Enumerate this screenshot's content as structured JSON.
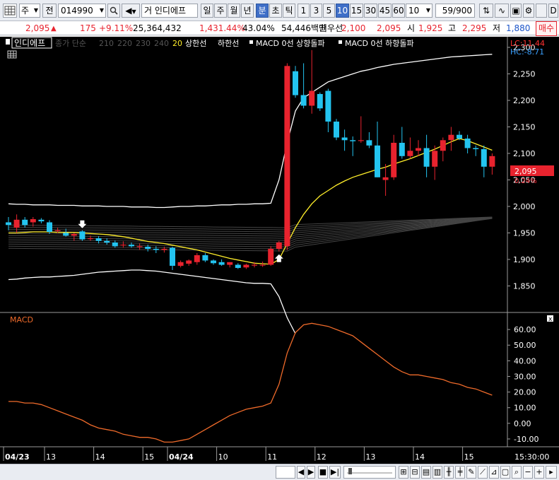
{
  "toolbar": {
    "market_select": "주",
    "prefix_select": "전",
    "stock_code": "014990",
    "stock_prefix": "거",
    "stock_name": "인디에프",
    "period_buttons": [
      "일",
      "주",
      "월",
      "년",
      "분",
      "초",
      "틱"
    ],
    "active_period": "분",
    "interval_buttons": [
      "1",
      "3",
      "5",
      "10",
      "15",
      "30",
      "45",
      "60"
    ],
    "active_interval": "10",
    "interval_value": "10",
    "count_value": "59",
    "count_total": "/900",
    "trailing_label": "D"
  },
  "quote": {
    "price": "2,095",
    "arrow": "▲",
    "change": "175",
    "change_pct": "+9.11%",
    "volume": "25,364,432",
    "volume_pct": "1,431.44%",
    "ratio": "43.04%",
    "amount": "54,446백만",
    "priority_label": "최우선",
    "ask": "2,100",
    "bid": "2,095",
    "open_label": "시",
    "open": "1,925",
    "high_label": "고",
    "high": "2,295",
    "low_label": "저",
    "low": "1,880",
    "trade_button": "매수"
  },
  "legend": {
    "name_tag": "인디에프",
    "ma_label": "종가 단순",
    "ma_periods": [
      "210",
      "220",
      "230",
      "240",
      "20"
    ],
    "upper_band": "상한선",
    "lower_band": "하한선",
    "macd_up": "MACD 0선 상향돌파",
    "macd_down": "MACD 0선 하향돌파"
  },
  "price_panel": {
    "lc": "LC:11.44",
    "hc": "HC:-8.71",
    "current_price_tag": "2,095",
    "current_pct_tag": "0.24%"
  },
  "macd_panel": {
    "title": "MACD",
    "close_icon": "x"
  },
  "x_axis_time": "15:30:00",
  "colors": {
    "up": "#e8232e",
    "down": "#23c4f0",
    "ma": "#ffee2a",
    "band": "#ffffff",
    "macd": "#ee6a2a",
    "bg": "#000000"
  },
  "chart_data": [
    {
      "type": "candlestick",
      "title": "인디에프",
      "ylim": [
        1800,
        2320
      ],
      "y_ticks": [
        "2,300",
        "2,250",
        "2,200",
        "2,150",
        "2,100",
        "2,050",
        "2,000",
        "1,950",
        "1,900",
        "1,850"
      ],
      "y_tick_values": [
        2300,
        2250,
        2200,
        2150,
        2100,
        2050,
        2000,
        1950,
        1900,
        1850
      ],
      "x_labels": [
        "04/23",
        "13",
        "14",
        "15",
        "04/24",
        "10",
        "11",
        "12",
        "13",
        "14",
        "15"
      ],
      "x_label_index": [
        0,
        5,
        11,
        17,
        20,
        26,
        32,
        38,
        44,
        50,
        56
      ],
      "candles": [
        {
          "o": 1970,
          "h": 1980,
          "l": 1955,
          "c": 1965
        },
        {
          "o": 1960,
          "h": 1985,
          "l": 1950,
          "c": 1975
        },
        {
          "o": 1975,
          "h": 1980,
          "l": 1960,
          "c": 1965
        },
        {
          "o": 1970,
          "h": 1980,
          "l": 1962,
          "c": 1976
        },
        {
          "o": 1975,
          "h": 1978,
          "l": 1968,
          "c": 1972
        },
        {
          "o": 1970,
          "h": 1974,
          "l": 1948,
          "c": 1952
        },
        {
          "o": 1955,
          "h": 1960,
          "l": 1950,
          "c": 1955
        },
        {
          "o": 1950,
          "h": 1958,
          "l": 1943,
          "c": 1945
        },
        {
          "o": 1945,
          "h": 1950,
          "l": 1935,
          "c": 1948
        },
        {
          "o": 1953,
          "h": 1955,
          "l": 1935,
          "c": 1938
        },
        {
          "o": 1940,
          "h": 1945,
          "l": 1935,
          "c": 1940
        },
        {
          "o": 1940,
          "h": 1944,
          "l": 1930,
          "c": 1935
        },
        {
          "o": 1935,
          "h": 1940,
          "l": 1928,
          "c": 1932
        },
        {
          "o": 1932,
          "h": 1936,
          "l": 1922,
          "c": 1925
        },
        {
          "o": 1928,
          "h": 1934,
          "l": 1922,
          "c": 1928
        },
        {
          "o": 1928,
          "h": 1932,
          "l": 1922,
          "c": 1925
        },
        {
          "o": 1925,
          "h": 1930,
          "l": 1918,
          "c": 1925
        },
        {
          "o": 1924,
          "h": 1928,
          "l": 1915,
          "c": 1920
        },
        {
          "o": 1920,
          "h": 1925,
          "l": 1912,
          "c": 1918
        },
        {
          "o": 1918,
          "h": 1924,
          "l": 1913,
          "c": 1920
        },
        {
          "o": 1922,
          "h": 1924,
          "l": 1880,
          "c": 1888
        },
        {
          "o": 1888,
          "h": 1898,
          "l": 1885,
          "c": 1895
        },
        {
          "o": 1892,
          "h": 1900,
          "l": 1888,
          "c": 1898
        },
        {
          "o": 1895,
          "h": 1912,
          "l": 1890,
          "c": 1908
        },
        {
          "o": 1908,
          "h": 1912,
          "l": 1895,
          "c": 1898
        },
        {
          "o": 1898,
          "h": 1900,
          "l": 1890,
          "c": 1893
        },
        {
          "o": 1895,
          "h": 1900,
          "l": 1888,
          "c": 1890
        },
        {
          "o": 1890,
          "h": 1895,
          "l": 1885,
          "c": 1895
        },
        {
          "o": 1890,
          "h": 1893,
          "l": 1882,
          "c": 1884
        },
        {
          "o": 1885,
          "h": 1892,
          "l": 1882,
          "c": 1890
        },
        {
          "o": 1890,
          "h": 1895,
          "l": 1885,
          "c": 1890
        },
        {
          "o": 1890,
          "h": 1896,
          "l": 1886,
          "c": 1890
        },
        {
          "o": 1890,
          "h": 1925,
          "l": 1888,
          "c": 1920
        },
        {
          "o": 1920,
          "h": 1935,
          "l": 1915,
          "c": 1932
        },
        {
          "o": 1925,
          "h": 2270,
          "l": 1918,
          "c": 2265
        },
        {
          "o": 2255,
          "h": 2265,
          "l": 2205,
          "c": 2210
        },
        {
          "o": 2210,
          "h": 2270,
          "l": 2185,
          "c": 2190
        },
        {
          "o": 2190,
          "h": 2295,
          "l": 2175,
          "c": 2218
        },
        {
          "o": 2212,
          "h": 2215,
          "l": 2180,
          "c": 2185
        },
        {
          "o": 2218,
          "h": 2222,
          "l": 2140,
          "c": 2160
        },
        {
          "o": 2160,
          "h": 2165,
          "l": 2125,
          "c": 2130
        },
        {
          "o": 2130,
          "h": 2145,
          "l": 2105,
          "c": 2125
        },
        {
          "o": 2125,
          "h": 2132,
          "l": 2095,
          "c": 2123
        },
        {
          "o": 2125,
          "h": 2170,
          "l": 2120,
          "c": 2125
        },
        {
          "o": 2125,
          "h": 2140,
          "l": 2110,
          "c": 2115
        },
        {
          "o": 2115,
          "h": 2160,
          "l": 2055,
          "c": 2055
        },
        {
          "o": 2050,
          "h": 2080,
          "l": 2020,
          "c": 2055
        },
        {
          "o": 2055,
          "h": 2135,
          "l": 2050,
          "c": 2120
        },
        {
          "o": 2120,
          "h": 2150,
          "l": 2090,
          "c": 2095
        },
        {
          "o": 2095,
          "h": 2130,
          "l": 2090,
          "c": 2105
        },
        {
          "o": 2105,
          "h": 2125,
          "l": 2095,
          "c": 2110
        },
        {
          "o": 2110,
          "h": 2135,
          "l": 2055,
          "c": 2075
        },
        {
          "o": 2075,
          "h": 2115,
          "l": 2050,
          "c": 2105
        },
        {
          "o": 2105,
          "h": 2130,
          "l": 2085,
          "c": 2125
        },
        {
          "o": 2125,
          "h": 2150,
          "l": 2105,
          "c": 2135
        },
        {
          "o": 2135,
          "h": 2142,
          "l": 2125,
          "c": 2128
        },
        {
          "o": 2128,
          "h": 2135,
          "l": 2100,
          "c": 2110
        },
        {
          "o": 2110,
          "h": 2115,
          "l": 2095,
          "c": 2108
        },
        {
          "o": 2108,
          "h": 2115,
          "l": 2055,
          "c": 2075
        },
        {
          "o": 2075,
          "h": 2100,
          "l": 2060,
          "c": 2095
        }
      ],
      "ma20": [
        1950,
        1950,
        1951,
        1952,
        1952,
        1952,
        1951,
        1951,
        1951,
        1950,
        1949,
        1948,
        1947,
        1945,
        1943,
        1940,
        1937,
        1934,
        1932,
        1930,
        1927,
        1924,
        1921,
        1918,
        1914,
        1910,
        1906,
        1902,
        1899,
        1896,
        1893,
        1892,
        1891,
        1900,
        1930,
        1960,
        1985,
        2005,
        2020,
        2030,
        2040,
        2048,
        2055,
        2060,
        2065,
        2070,
        2074,
        2080,
        2085,
        2090,
        2096,
        2102,
        2108,
        2115,
        2122,
        2128,
        2124,
        2118,
        2112,
        2106
      ],
      "upper_band": [
        2005,
        2004,
        2004,
        2003,
        2003,
        2003,
        2002,
        2002,
        2002,
        2001,
        2001,
        2001,
        2000,
        2000,
        2000,
        1999,
        1999,
        1999,
        1998,
        1998,
        1999,
        2000,
        2000,
        2001,
        2001,
        2002,
        2003,
        2003,
        2004,
        2004,
        2005,
        2005,
        2006,
        2050,
        2120,
        2180,
        2205,
        2215,
        2225,
        2235,
        2240,
        2245,
        2250,
        2255,
        2258,
        2262,
        2265,
        2268,
        2270,
        2272,
        2274,
        2276,
        2278,
        2280,
        2282,
        2283,
        2284,
        2285,
        2286,
        2287
      ],
      "lower_band": [
        1862,
        1863,
        1865,
        1866,
        1867,
        1867,
        1868,
        1869,
        1870,
        1872,
        1874,
        1876,
        1877,
        1878,
        1879,
        1880,
        1880,
        1879,
        1878,
        1876,
        1874,
        1872,
        1870,
        1868,
        1866,
        1864,
        1862,
        1860,
        1858,
        1856,
        1855,
        1855,
        1854,
        1830,
        1790,
        1760,
        null,
        null,
        null,
        null,
        null,
        null,
        null,
        null,
        null,
        null,
        null,
        null,
        null,
        null,
        null,
        null,
        null,
        null,
        null,
        null,
        null,
        null,
        null,
        1810
      ],
      "signal_markers": [
        {
          "index": 9,
          "type": "down"
        },
        {
          "index": 33,
          "type": "up"
        }
      ]
    },
    {
      "type": "line",
      "title": "MACD",
      "ylim": [
        -15,
        70
      ],
      "y_ticks": [
        "60.00",
        "50.00",
        "40.00",
        "30.00",
        "20.00",
        "10.00",
        "0.00",
        "-10.00"
      ],
      "y_tick_values": [
        60,
        50,
        40,
        30,
        20,
        10,
        0,
        -10
      ],
      "series": [
        {
          "name": "MACD",
          "values": [
            14,
            14,
            13,
            13,
            12,
            10,
            8,
            6,
            4,
            2,
            -1,
            -3,
            -4,
            -5,
            -7,
            -8,
            -9,
            -9,
            -10,
            -12,
            -12,
            -11,
            -10,
            -7,
            -4,
            -1,
            2,
            5,
            7,
            9,
            10,
            11,
            13,
            25,
            45,
            58,
            63,
            64,
            63,
            62,
            60,
            58,
            56,
            52,
            48,
            44,
            40,
            36,
            33,
            31,
            31,
            30,
            29,
            28,
            26,
            25,
            23,
            22,
            20,
            18
          ]
        }
      ]
    }
  ]
}
